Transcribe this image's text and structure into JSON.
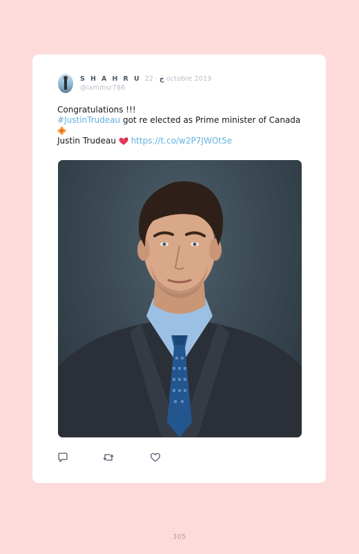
{
  "tweet": {
    "name": "S H A H R U خ",
    "date": "· 22 octobre 2019",
    "handle": "@iammsr786",
    "line1": "Congratulations !!!",
    "hashtag": "#JustinTrudeau",
    "line2_rest": " got re elected as Prime minister of Canada",
    "line3_text": "Justin Trudeau",
    "link": "https://t.co/w2P7JWOt5e"
  },
  "icons": {
    "reply": "reply-icon",
    "retweet": "retweet-icon",
    "like": "heart-icon",
    "flower": "flower-emoji-icon",
    "heart_emoji": "heart-emoji-icon"
  },
  "colors": {
    "background": "#fedbdb",
    "card": "#ffffff",
    "link": "#5fb0df",
    "name": "#4b5968",
    "muted": "#b6bec7"
  },
  "page_number": "305"
}
